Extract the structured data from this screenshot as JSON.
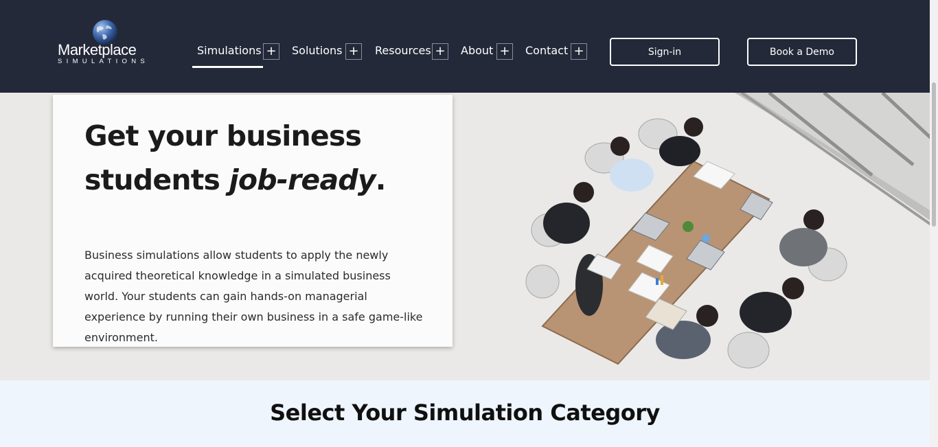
{
  "brand": {
    "name": "Marketplace",
    "tagline": "SIMULATIONS",
    "icon": "globe-icon"
  },
  "nav": {
    "items": [
      {
        "label": "Simulations",
        "expand_icon": "plus-icon",
        "active": true
      },
      {
        "label": "Solutions",
        "expand_icon": "plus-icon"
      },
      {
        "label": "Resources",
        "expand_icon": "plus-icon"
      },
      {
        "label": "About",
        "expand_icon": "plus-icon"
      },
      {
        "label": "Contact",
        "expand_icon": "plus-icon"
      }
    ],
    "signin_label": "Sign-in",
    "demo_label": "Book a Demo"
  },
  "hero": {
    "title_line1": "Get your business",
    "title_line2_start": "students ",
    "title_emphasis": "job-ready",
    "title_end": ".",
    "description": "Business simulations allow students to apply the newly acquired theoretical knowledge in a simulated business world. Your students can gain hands-on managerial experience by running their own business in a safe game-like environment."
  },
  "category_section": {
    "title": "Select Your Simulation Category"
  },
  "colors": {
    "header_bg": "#232939",
    "section_bg": "#eef5fd",
    "text_dark": "#1b1b1b",
    "white": "#ffffff"
  }
}
